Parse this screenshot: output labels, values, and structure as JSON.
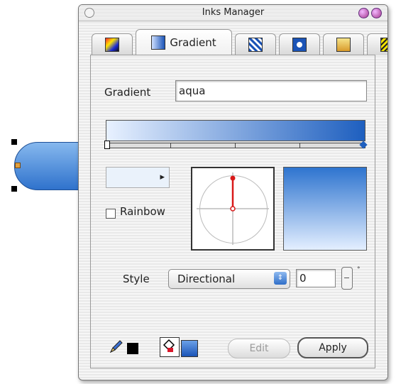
{
  "window": {
    "title": "Inks Manager"
  },
  "tabs": [
    {
      "label": "",
      "icon": "ink-mixer-icon",
      "active": false
    },
    {
      "label": "Gradient",
      "icon": "gradient-tab-icon",
      "active": true
    },
    {
      "label": "",
      "icon": "pattern-icon",
      "active": false
    },
    {
      "label": "",
      "icon": "texture-icon",
      "active": false
    },
    {
      "label": "",
      "icon": "image-fill-icon",
      "active": false
    },
    {
      "label": "",
      "icon": "hatch-icon",
      "active": false
    }
  ],
  "gradient": {
    "name_label": "Gradient",
    "name_value": "aqua",
    "start_color": "#e8f1ff",
    "end_color": "#1e5fbf"
  },
  "rainbow": {
    "label": "Rainbow",
    "checked": false
  },
  "style": {
    "label": "Style",
    "value": "Directional",
    "angle": "0",
    "unit": "°"
  },
  "buttons": {
    "edit": "Edit",
    "apply": "Apply"
  }
}
